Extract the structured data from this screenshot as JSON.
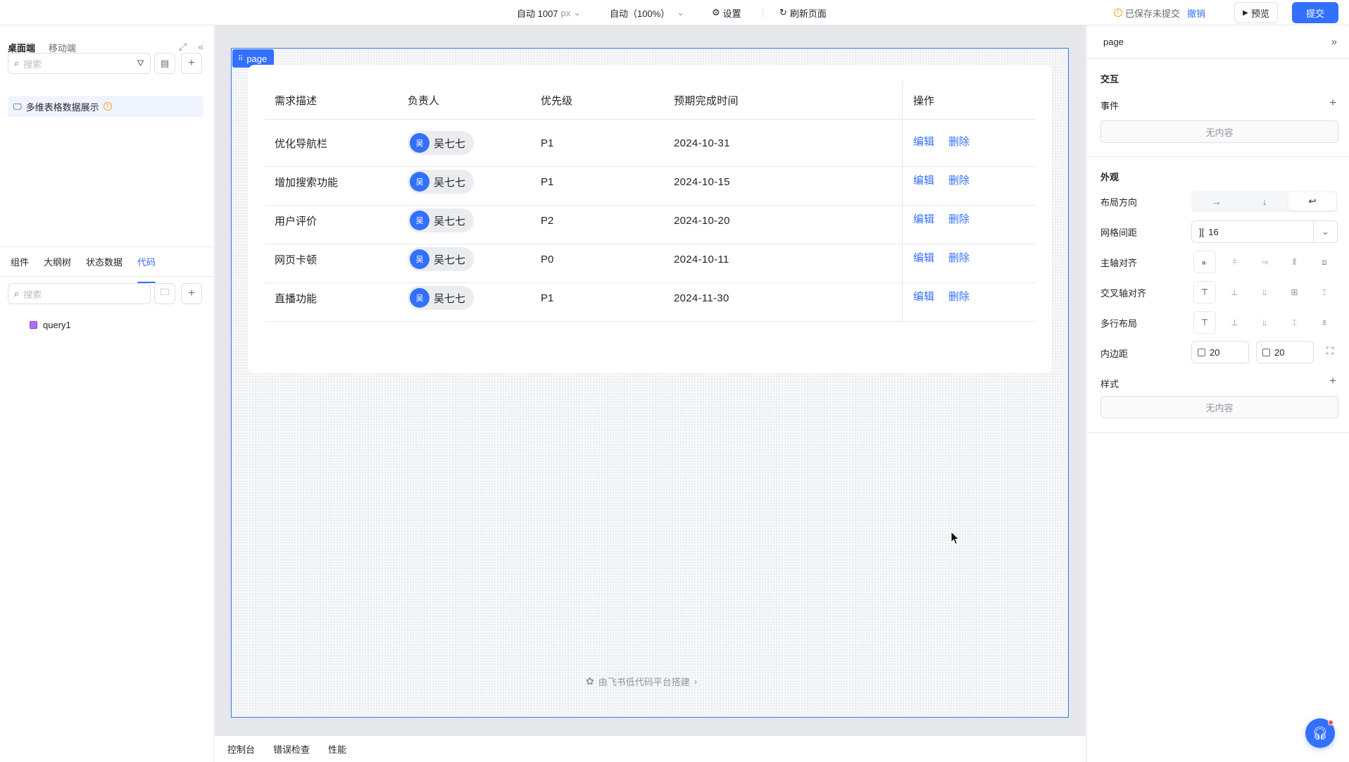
{
  "topbar": {
    "width_mode": "自动 1007",
    "width_unit": "px",
    "zoom": "自动（100%）",
    "settings": "设置",
    "refresh": "刷新页面",
    "saved_status": "已保存未提交",
    "undo": "撤销",
    "preview": "预览",
    "submit": "提交"
  },
  "left": {
    "tabs": [
      "桌面端",
      "移动端"
    ],
    "search_placeholder": "搜索",
    "page_item": "多维表格数据展示",
    "bottom_tabs": [
      "组件",
      "大纲树",
      "状态数据",
      "代码"
    ],
    "code_search_placeholder": "搜索",
    "query": "query1"
  },
  "canvas": {
    "page_tag": "page",
    "footer": "由飞书低代码平台搭建"
  },
  "table": {
    "headers": [
      "需求描述",
      "负责人",
      "优先级",
      "预期完成时间",
      "操作"
    ],
    "rows": [
      {
        "desc": "优化导航栏",
        "owner": "吴七七",
        "avatar": "吴",
        "priority": "P1",
        "date": "2024-10-31"
      },
      {
        "desc": "增加搜索功能",
        "owner": "吴七七",
        "avatar": "吴",
        "priority": "P1",
        "date": "2024-10-15"
      },
      {
        "desc": "用户评价",
        "owner": "吴七七",
        "avatar": "吴",
        "priority": "P2",
        "date": "2024-10-20"
      },
      {
        "desc": "网页卡顿",
        "owner": "吴七七",
        "avatar": "吴",
        "priority": "P0",
        "date": "2024-10-11"
      },
      {
        "desc": "直播功能",
        "owner": "吴七七",
        "avatar": "吴",
        "priority": "P1",
        "date": "2024-11-30"
      }
    ],
    "edit": "编辑",
    "delete": "删除"
  },
  "console": [
    "控制台",
    "错误检查",
    "性能"
  ],
  "right": {
    "title": "page",
    "interaction": "交互",
    "event": "事件",
    "empty": "无内容",
    "appearance": "外观",
    "layout_dir": "布局方向",
    "grid_gap": "网格间距",
    "grid_gap_value": "16",
    "main_align": "主轴对齐",
    "cross_align": "交叉轴对齐",
    "multi_line": "多行布局",
    "padding": "内边距",
    "padding_a": "20",
    "padding_b": "20",
    "style": "样式"
  },
  "colors": {
    "accent": "#3370ff",
    "warn": "#f5a623"
  }
}
